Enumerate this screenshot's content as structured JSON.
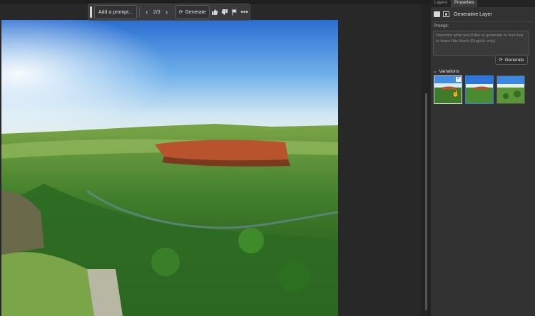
{
  "taskbar": {
    "prompt_label": "Add a prompt...",
    "counter": "2/3",
    "generate_label": "Generate"
  },
  "panel": {
    "tabs": [
      "Layers",
      "Properties"
    ],
    "active_tab": "Properties",
    "layer_title": "Generative Layer",
    "prompt_label": "Prompt:",
    "prompt_placeholder": "Describe what you'd like to generate or feel free to leave this blank (English only).",
    "generate_label": "Generate",
    "variations_label": "Variations",
    "variation_count": 3,
    "selected_variation": 2
  },
  "colors": {
    "accent": "#2f80ed",
    "panel_bg": "#323232",
    "workspace_bg": "#282828"
  },
  "icons": [
    "chevron-left-icon",
    "chevron-right-icon",
    "refresh-icon",
    "thumbs-up-icon",
    "thumbs-down-icon",
    "flag-icon",
    "more-icon",
    "close-icon",
    "chevron-down-icon"
  ]
}
